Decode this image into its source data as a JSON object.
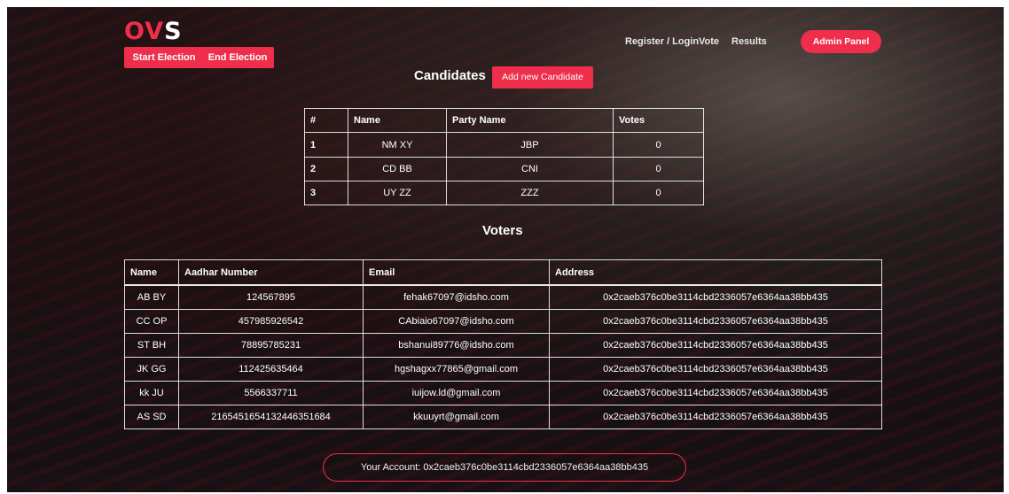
{
  "brand": {
    "part1": "O",
    "part2": "V",
    "part3": "S"
  },
  "admin_actions": {
    "start_election": "Start Election",
    "end_election": "End Election"
  },
  "nav": {
    "register_login": "Register / Login",
    "vote": "Vote",
    "results": "Results",
    "admin_panel": "Admin Panel"
  },
  "colors": {
    "accent": "#ee2e4a"
  },
  "candidates": {
    "title": "Candidates",
    "add_button": "Add new Candidate",
    "headers": [
      "#",
      "Name",
      "Party Name",
      "Votes"
    ],
    "rows": [
      {
        "index": "1",
        "name": "NM XY",
        "party": "JBP",
        "votes": "0"
      },
      {
        "index": "2",
        "name": "CD BB",
        "party": "CNI",
        "votes": "0"
      },
      {
        "index": "3",
        "name": "UY ZZ",
        "party": "ZZZ",
        "votes": "0"
      }
    ]
  },
  "voters": {
    "title": "Voters",
    "headers": [
      "Name",
      "Aadhar Number",
      "Email",
      "Address"
    ],
    "rows": [
      {
        "name": "AB BY",
        "aadhar": "124567895",
        "email": "fehak67097@idsho.com",
        "address": "0x2caeb376c0be3114cbd2336057e6364aa38bb435"
      },
      {
        "name": "CC OP",
        "aadhar": "457985926542",
        "email": "CAbiaio67097@idsho.com",
        "address": "0x2caeb376c0be3114cbd2336057e6364aa38bb435"
      },
      {
        "name": "ST BH",
        "aadhar": "78895785231",
        "email": "bshanui89776@idsho.com",
        "address": "0x2caeb376c0be3114cbd2336057e6364aa38bb435"
      },
      {
        "name": "JK GG",
        "aadhar": "112425635464",
        "email": "hgshagxx77865@gmail.com",
        "address": "0x2caeb376c0be3114cbd2336057e6364aa38bb435"
      },
      {
        "name": "kk JU",
        "aadhar": "5566337711",
        "email": "iuijow.ld@gmail.com",
        "address": "0x2caeb376c0be3114cbd2336057e6364aa38bb435"
      },
      {
        "name": "AS SD",
        "aadhar": "2165451654132446351684",
        "email": "kkuuyrt@gmail.com",
        "address": "0x2caeb376c0be3114cbd2336057e6364aa38bb435"
      }
    ]
  },
  "account": {
    "text": "Your Account: 0x2caeb376c0be3114cbd2336057e6364aa38bb435"
  }
}
